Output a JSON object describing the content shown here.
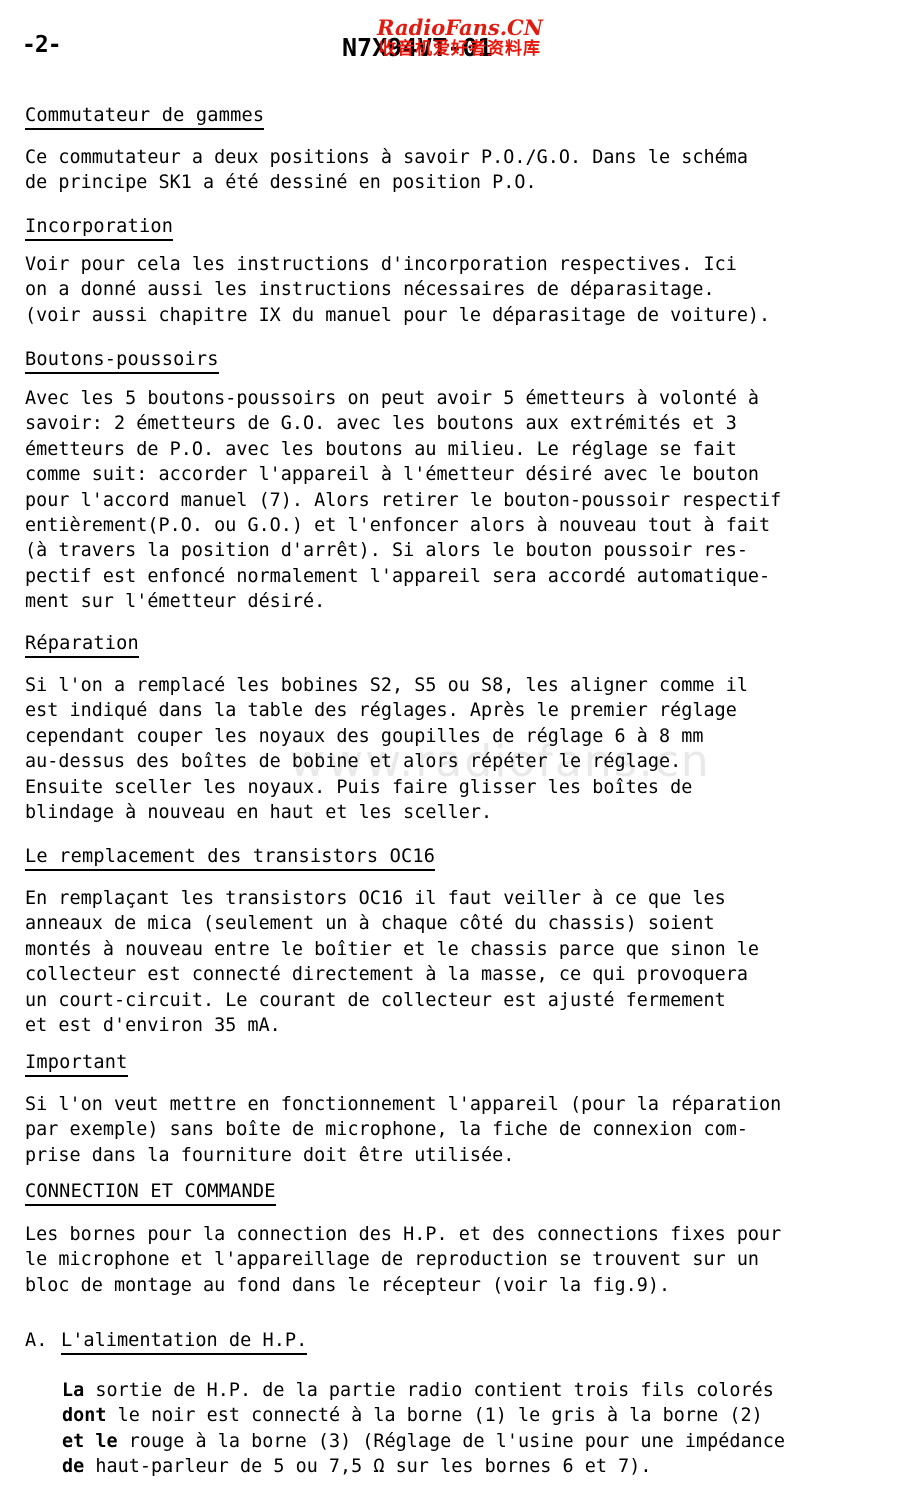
{
  "header": {
    "page_number": "-2-",
    "document_code": "N7X94VT-01"
  },
  "watermarks": {
    "red_line1": "RadioFans.CN",
    "red_line2": "收音机爱好者资料库",
    "red_color": "#e01b10",
    "faint_text": "www.radiofans.cn",
    "faint_color": "#e9e9e9"
  },
  "sections": [
    {
      "heading": "Commutateur de gammes",
      "lines": [
        "Ce commutateur a deux positions à savoir P.O./G.O. Dans le schéma",
        "de principe SK1 a été dessiné en position P.O."
      ]
    },
    {
      "heading": "Incorporation",
      "lines": [
        "Voir pour cela les instructions d'incorporation respectives. Ici",
        "on a donné aussi les instructions nécessaires de déparasitage.",
        "(voir aussi chapitre IX du manuel pour le déparasitage de voiture)."
      ]
    },
    {
      "heading": "Boutons-poussoirs",
      "lines": [
        "Avec les 5 boutons-poussoirs on peut avoir 5 émetteurs à volonté à",
        "savoir: 2 émetteurs de G.O. avec les boutons aux extrémités et 3",
        "émetteurs de P.O. avec les boutons au milieu. Le réglage se fait",
        "comme suit: accorder l'appareil à l'émetteur désiré avec le bouton",
        "pour l'accord manuel (7). Alors retirer le bouton-poussoir respectif",
        "entièrement(P.O. ou G.O.) et l'enfoncer alors à nouveau tout à fait",
        "(à travers la position d'arrêt). Si alors le bouton poussoir res-",
        "pectif est enfoncé normalement l'appareil sera accordé automatique-",
        "ment sur l'émetteur désiré."
      ]
    },
    {
      "heading": "Réparation",
      "lines": [
        "Si l'on a remplacé les bobines S2, S5 ou S8, les aligner comme il",
        "est indiqué dans la table des réglages. Après le premier réglage",
        "cependant couper les noyaux des goupilles de réglage 6 à 8 mm",
        "au-dessus des boîtes de bobine et alors répéter le réglage.",
        "Ensuite sceller les noyaux. Puis faire glisser les boîtes de",
        "blindage à nouveau en haut et les sceller."
      ]
    },
    {
      "heading": "Le remplacement des transistors OC16",
      "lines": [
        "En remplaçant les transistors OC16 il faut veiller à ce que les",
        "anneaux de mica (seulement un à chaque côté du chassis) soient",
        "montés à nouveau entre le boîtier et le chassis parce que sinon le",
        "collecteur est connecté directement à la masse, ce qui provoquera",
        "un court-circuit. Le courant de collecteur est ajusté fermement",
        "et est d'environ 35 mA."
      ]
    },
    {
      "heading": "Important",
      "lines": [
        "Si l'on veut mettre en fonctionnement l'appareil (pour la réparation",
        "par exemple) sans boîte de microphone, la fiche de connexion com-",
        "prise dans la fourniture doit être utilisée."
      ]
    },
    {
      "heading": "CONNECTION ET COMMANDE",
      "lines": [
        "Les bornes pour la connection des H.P. et des connections fixes pour",
        "le microphone et l'appareillage de reproduction se trouvent sur un",
        "bloc de montage au fond dans le récepteur (voir la fig.9)."
      ]
    }
  ],
  "subsection": {
    "marker": "A.",
    "heading": "L'alimentation de H.P.",
    "lines": [
      {
        "lead": "La",
        "rest": " sortie de H.P. de la partie radio contient trois fils colorés"
      },
      {
        "lead": "dont",
        "rest": " le noir est connecté à la borne (1) le gris à la borne (2)"
      },
      {
        "lead": "et le",
        "rest": " rouge à la borne (3) (Réglage de l'usine pour une impédance"
      },
      {
        "lead": "de",
        "rest": " haut-parleur de 5 ou 7,5 Ω sur les bornes 6 et 7)."
      }
    ]
  }
}
